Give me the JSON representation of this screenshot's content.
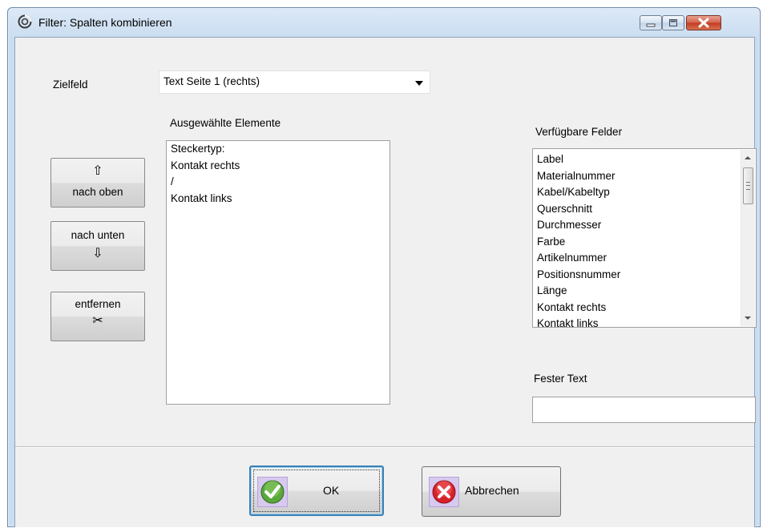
{
  "window": {
    "title": "Filter: Spalten kombinieren",
    "icons": {
      "app": "app-icon",
      "minimize": "minimize-icon",
      "maximize": "maximize-icon",
      "close": "close-icon"
    },
    "colors": {
      "title_gradient_top": "#dce9f7",
      "client_bg": "#f0f0f0",
      "close_button": "#c23b1f"
    }
  },
  "target_field": {
    "label": "Zielfeld",
    "selected": "Text Seite 1 (rechts)"
  },
  "selected_elements": {
    "header": "Ausgewählte Elemente",
    "items": [
      "Steckertyp:",
      "Kontakt rechts",
      "/",
      "Kontakt links"
    ]
  },
  "buttons": {
    "up": {
      "label": "nach oben",
      "icon": "arrow-up-icon",
      "glyph": "⇧"
    },
    "down": {
      "label": "nach unten",
      "icon": "arrow-down-icon",
      "glyph": "⇩"
    },
    "remove": {
      "label": "entfernen",
      "icon": "scissors-icon",
      "glyph": "✂"
    }
  },
  "available_fields": {
    "header": "Verfügbare Felder",
    "items": [
      "Label",
      "Materialnummer",
      "Kabel/Kabeltyp",
      "Querschnitt",
      "Durchmesser",
      "Farbe",
      "Artikelnummer",
      "Positionsnummer",
      "Länge",
      "Kontakt rechts",
      "Kontakt links"
    ]
  },
  "fixed_text": {
    "label": "Fester Text",
    "value": ""
  },
  "footer": {
    "ok_label": "OK",
    "ok_icon": "checkmark-icon",
    "cancel_label": "Abbrechen",
    "cancel_icon": "cancel-x-icon"
  }
}
